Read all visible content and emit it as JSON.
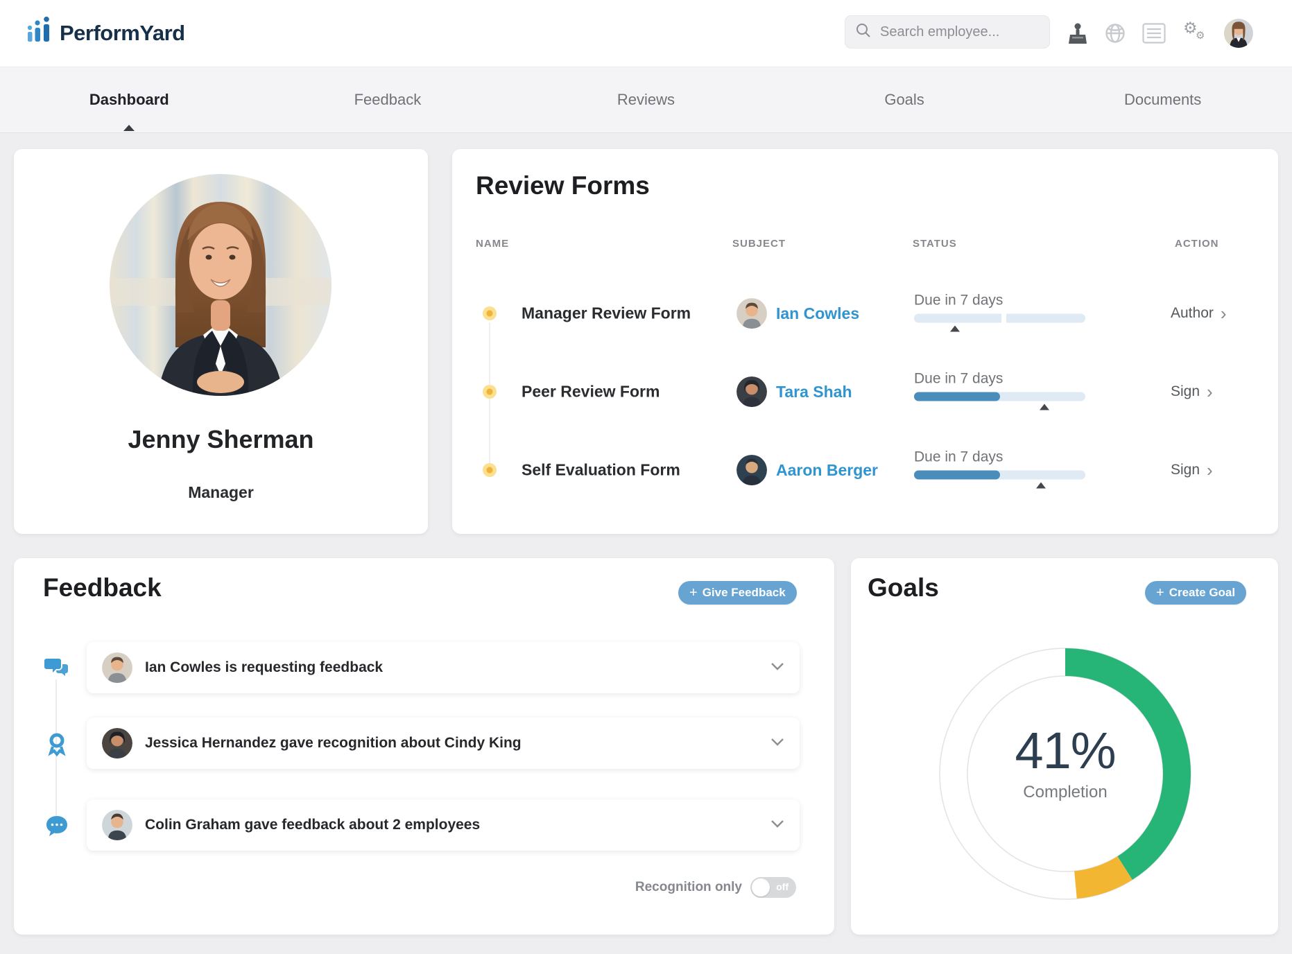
{
  "header": {
    "logo_text": "PerformYard",
    "search_placeholder": "Search employee..."
  },
  "nav": {
    "tabs": [
      {
        "label": "Dashboard",
        "active": true
      },
      {
        "label": "Feedback",
        "active": false
      },
      {
        "label": "Reviews",
        "active": false
      },
      {
        "label": "Goals",
        "active": false
      },
      {
        "label": "Documents",
        "active": false
      }
    ]
  },
  "profile": {
    "name": "Jenny Sherman",
    "role": "Manager"
  },
  "review_forms": {
    "title": "Review Forms",
    "columns": [
      "NAME",
      "SUBJECT",
      "STATUS",
      "ACTION"
    ],
    "rows": [
      {
        "name": "Manager Review Form",
        "subject": "Ian Cowles",
        "status_text": "Due in 7 days",
        "progress_fill_percent": 0,
        "progress_gap_percent": 51,
        "marker_percent": 24,
        "action": "Author"
      },
      {
        "name": "Peer Review Form",
        "subject": "Tara Shah",
        "status_text": "Due in 7 days",
        "progress_fill_percent": 50,
        "progress_gap_percent": null,
        "marker_percent": 76,
        "action": "Sign"
      },
      {
        "name": "Self Evaluation Form",
        "subject": "Aaron Berger",
        "status_text": "Due in 7 days",
        "progress_fill_percent": 50,
        "progress_gap_percent": null,
        "marker_percent": 74,
        "action": "Sign"
      }
    ]
  },
  "feedback": {
    "title": "Feedback",
    "give_feedback_label": "Give Feedback",
    "items": [
      {
        "icon": "chat-bubbles-icon",
        "text": "Ian Cowles is requesting feedback",
        "text_bold": ""
      },
      {
        "icon": "recognition-medal-icon",
        "text": "Jessica Hernandez gave recognition about Cindy King",
        "text_bold": ""
      },
      {
        "icon": "speech-bubble-icon",
        "text": "Colin Graham gave feedback about ",
        "text_bold": "2 employees"
      }
    ],
    "recognition_only_label": "Recognition only",
    "toggle_state": "off"
  },
  "goals": {
    "title": "Goals",
    "create_goal_label": "Create Goal",
    "chart_data": {
      "type": "donut",
      "center_label": "41%",
      "center_sublabel": "Completion",
      "segments": [
        {
          "name": "complete",
          "value": 41,
          "color": "#27b477"
        },
        {
          "name": "in_progress",
          "value": 7.5,
          "color": "#f2b632"
        },
        {
          "name": "remaining",
          "value": 51.5,
          "color": "#ffffff"
        }
      ]
    }
  },
  "colors": {
    "accent_blue": "#2f94d0",
    "button_blue": "#67a4d2",
    "bar_fill": "#4a8cba",
    "bar_track": "#dfeaf4",
    "green": "#27b477",
    "yellow": "#f2b632"
  }
}
